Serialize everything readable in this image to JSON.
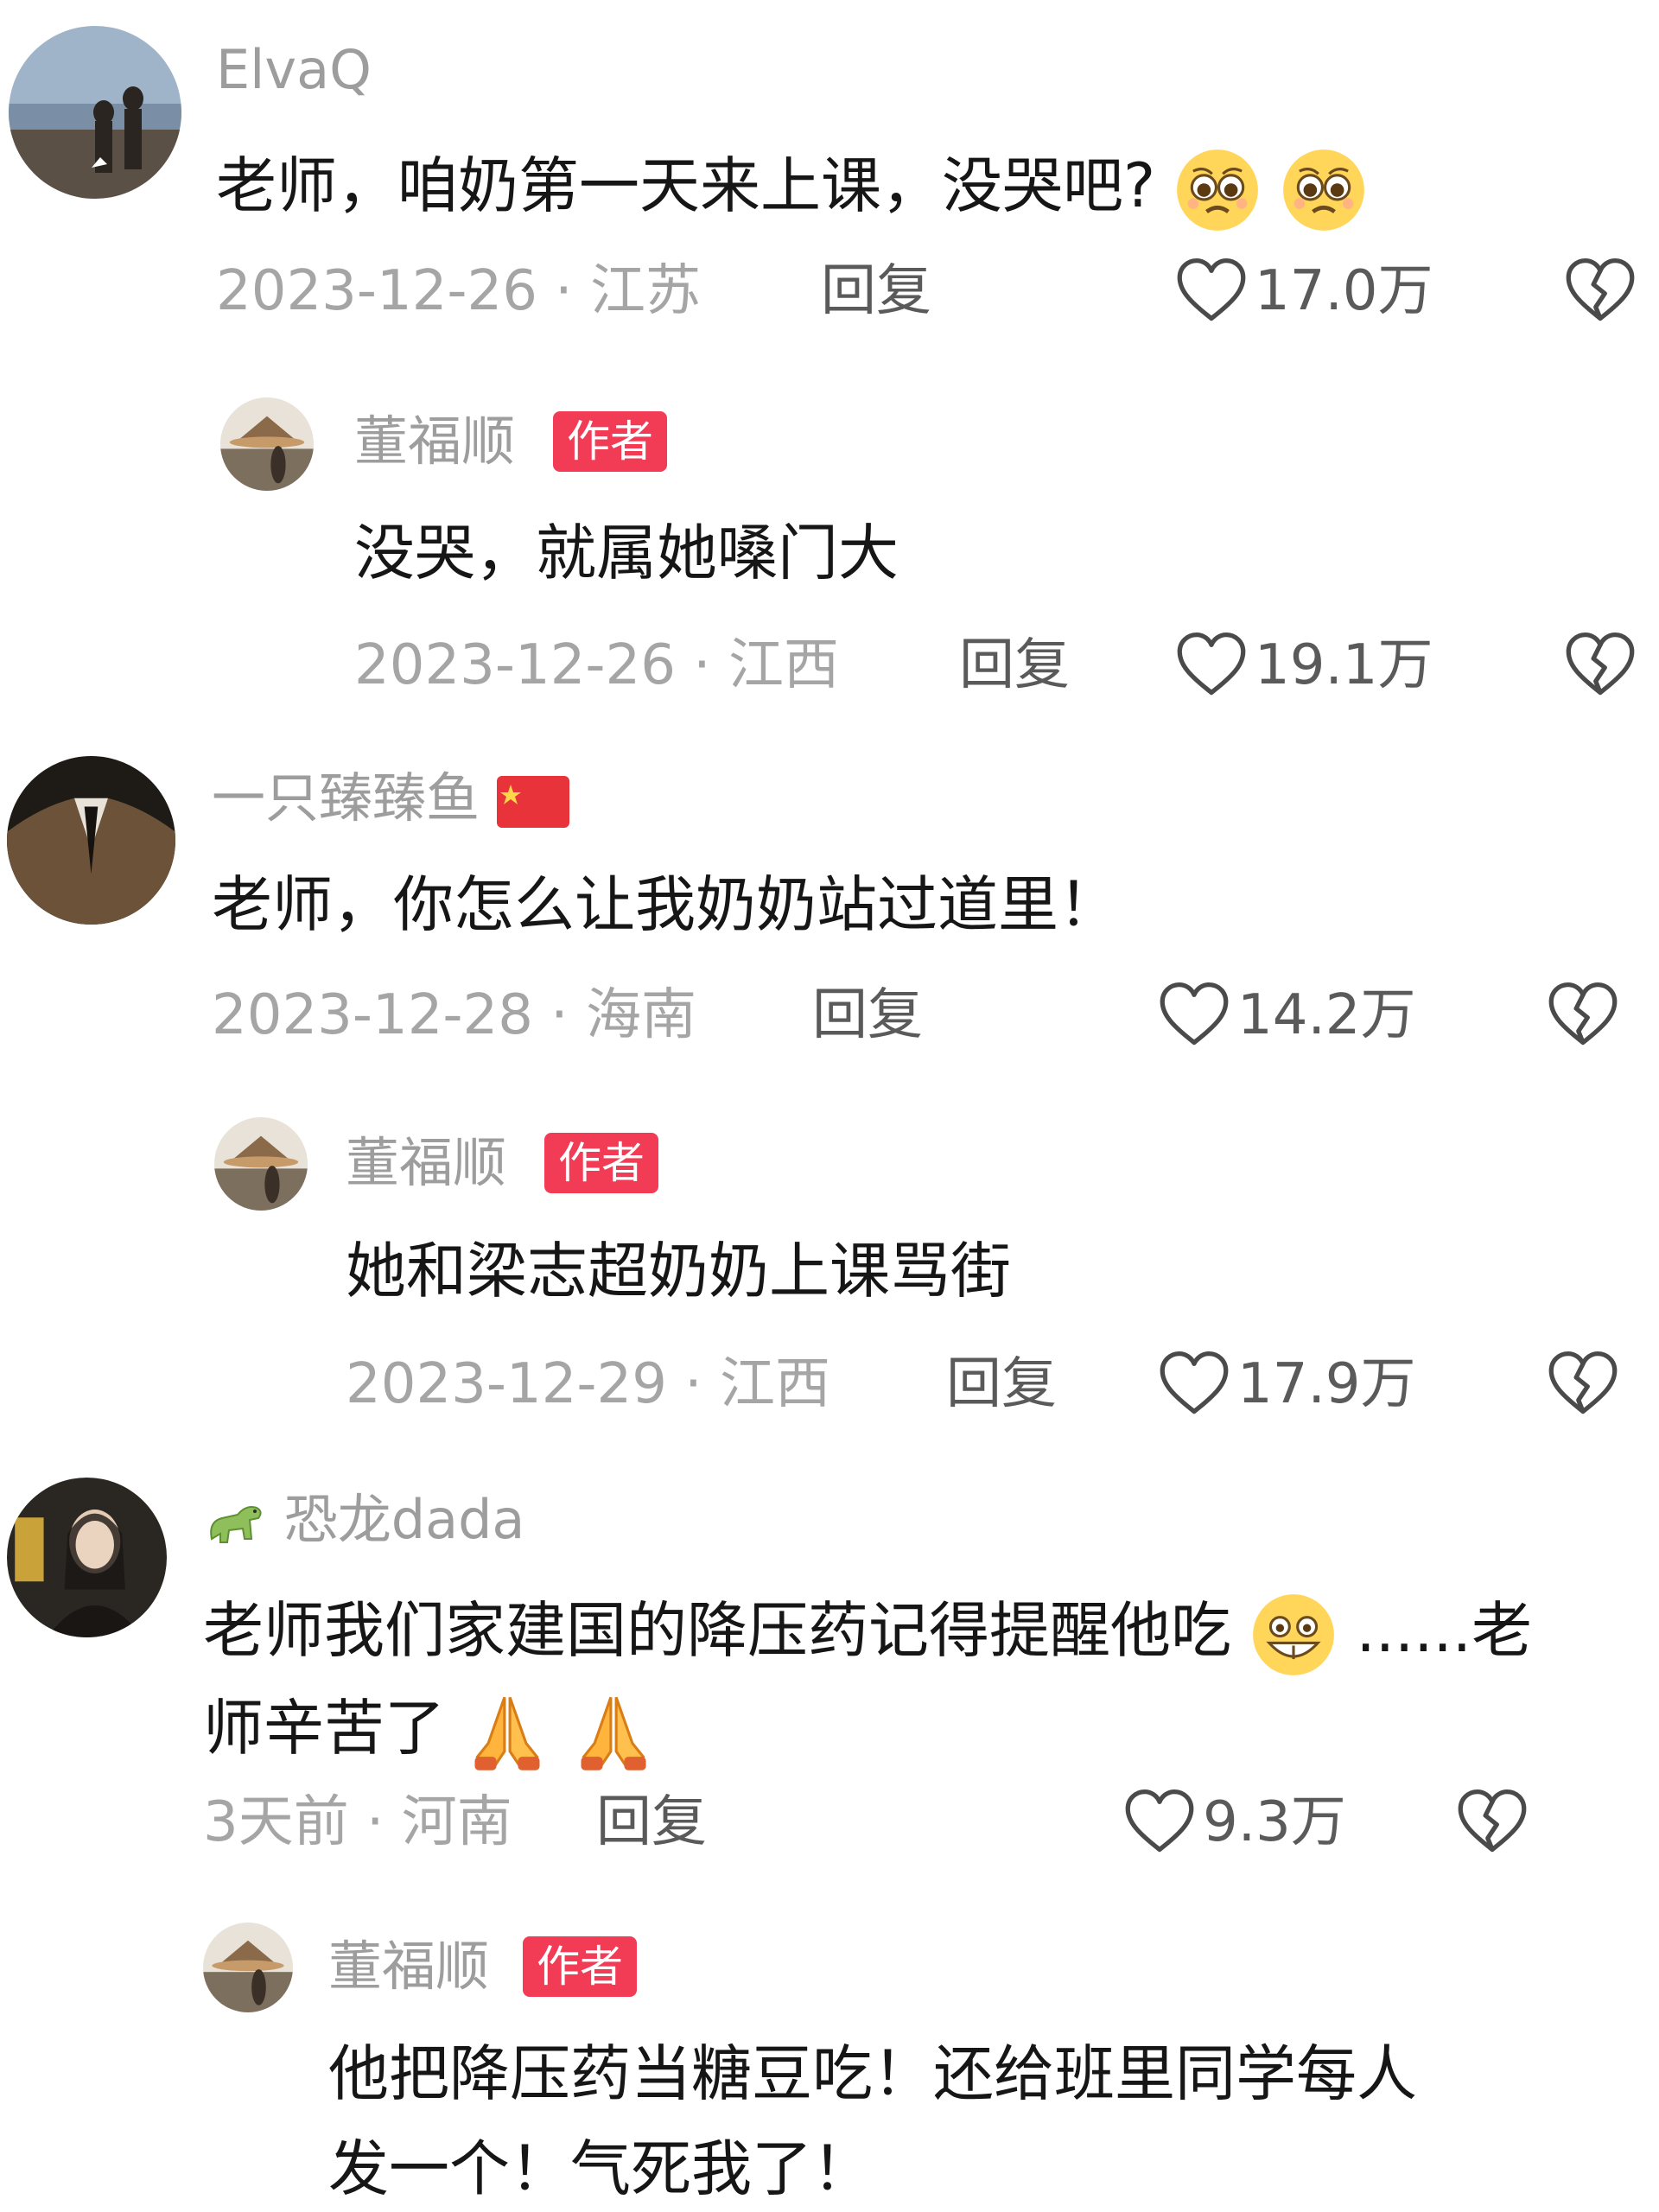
{
  "comments": [
    {
      "username": "ElvaQ",
      "text": "老师，咱奶第一天来上课，没哭吧?",
      "emojis": [
        "pleading-face",
        "pleading-face"
      ],
      "date_location": "2023-12-26 · 江苏",
      "reply_label": "回复",
      "likes": "17.0万",
      "reply": {
        "username": "董福顺",
        "badge": "作者",
        "text": "没哭，就属她嗓门大",
        "date_location": "2023-12-26 · 江西",
        "reply_label": "回复",
        "likes": "19.1万"
      }
    },
    {
      "username": "一只臻臻鱼",
      "username_suffix_icon": "china-flag-icon",
      "text": "老师，你怎么让我奶奶站过道里！",
      "date_location": "2023-12-28 · 海南",
      "reply_label": "回复",
      "likes": "14.2万",
      "reply": {
        "username": "董福顺",
        "badge": "作者",
        "text": "她和梁志超奶奶上课骂街",
        "date_location": "2023-12-29 · 江西",
        "reply_label": "回复",
        "likes": "17.9万"
      }
    },
    {
      "username_prefix_icon": "dinosaur-icon",
      "username": "恐龙dada",
      "text_line1": "老师我们家建国的降压药记得提醒他吃",
      "text_line1_after_emoji": "......老",
      "text_line2": "师辛苦了",
      "emojis": [
        "grinning-face",
        "folded-hands",
        "folded-hands"
      ],
      "date_location": "3天前 · 河南",
      "reply_label": "回复",
      "likes": "9.3万",
      "reply": {
        "username": "董福顺",
        "badge": "作者",
        "text_line1": "他把降压药当糖豆吃！还给班里同学每人",
        "text_line2": "发一个！气死我了！"
      }
    }
  ],
  "colors": {
    "badge": "#f23b55",
    "username": "#9d9d9d",
    "content": "#161616",
    "meta": "#a5a5a5"
  }
}
